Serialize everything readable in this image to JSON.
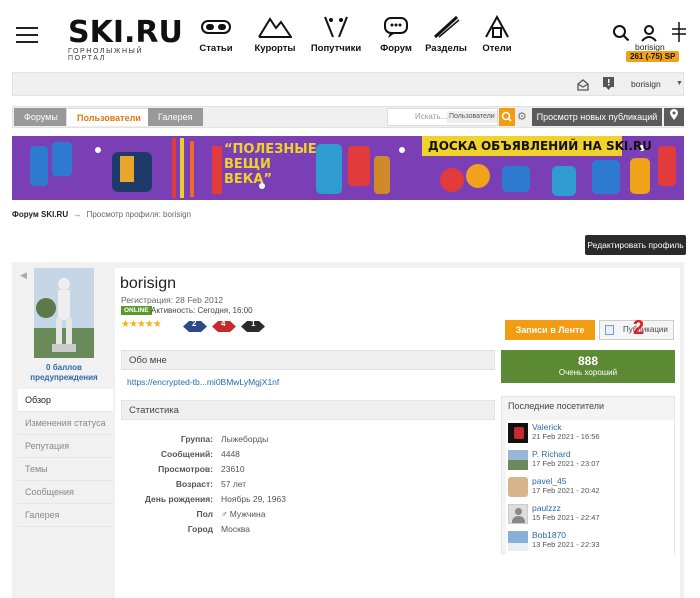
{
  "header": {
    "logo_text": "SKI.RU",
    "logo_subtitle": "ГОРНОЛЫЖНЫЙ ПОРТАЛ",
    "nav": [
      {
        "label": "Статьи",
        "icon": "goggles-icon"
      },
      {
        "label": "Курорты",
        "icon": "mountains-icon"
      },
      {
        "label": "Попутчики",
        "icon": "skiers-icon"
      },
      {
        "label": "Форум",
        "icon": "forum-icon"
      },
      {
        "label": "Разделы",
        "icon": "ski-icon"
      },
      {
        "label": "Отели",
        "icon": "hotel-icon"
      }
    ],
    "user_name": "borisign",
    "user_sp": "261 (-75) SP"
  },
  "userbar": {
    "user_name": "borisign"
  },
  "tabs": {
    "items": [
      "Форумы",
      "Пользователи",
      "Галерея"
    ],
    "active": "Пользователи",
    "search_placeholder": "Искать...",
    "search_scope": "Пользователи",
    "new_posts": "Просмотр новых публикаций"
  },
  "banner": {
    "text_left": "“ПОЛЕЗНЫЕ ВЕЩИ ВЕКА”",
    "text_right": "ДОСКА ОБЪЯВЛЕНИЙ НА SKI.RU"
  },
  "breadcrumb": {
    "root": "Форум SKI.RU",
    "sep": "→",
    "current": "Просмотр профиля: borisign"
  },
  "edit_profile": "Редактировать профиль",
  "profile": {
    "points": "0 баллов",
    "warnings": "предупреждения",
    "name": "borisign",
    "registration": "Регистрация: 28 Feb 2012",
    "online_badge": "ONLINE",
    "activity": "Активность: Сегодня, 16:00",
    "rank_badges": [
      "2",
      "4",
      "1"
    ],
    "feed_button": "Записи в Ленте",
    "publications_button": "Публикации",
    "step_number": "2"
  },
  "sidebar_menu": [
    "Обзор",
    "Изменения статуса",
    "Репутация",
    "Темы",
    "Сообщения",
    "Галерея"
  ],
  "about": {
    "title": "Обо мне",
    "link": "https://encrypted-tb...mi0BMwLyMgjX1nf"
  },
  "stats": {
    "title": "Статистика",
    "rows": [
      {
        "label": "Группа:",
        "value": "Лыжеборды"
      },
      {
        "label": "Сообщений:",
        "value": "4448"
      },
      {
        "label": "Просмотров:",
        "value": "23610"
      },
      {
        "label": "Возраст:",
        "value": "57 лет"
      },
      {
        "label": "День рождения:",
        "value": "Ноябрь 29, 1963"
      },
      {
        "label": "Пол",
        "value": "Мужчина"
      },
      {
        "label": "Город",
        "value": "Москва"
      }
    ]
  },
  "reputation": {
    "value": "888",
    "label": "Очень хороший",
    "color": "#5c8a34"
  },
  "visitors": {
    "title": "Последние посетители",
    "items": [
      {
        "name": "Valerick",
        "date": "21 Feb 2021 - 16:56"
      },
      {
        "name": "P. Richard",
        "date": "17 Feb 2021 - 23:07"
      },
      {
        "name": "pavel_45",
        "date": "17 Feb 2021 - 20:42"
      },
      {
        "name": "paulzzz",
        "date": "15 Feb 2021 - 22:47"
      },
      {
        "name": "Bob1870",
        "date": "13 Feb 2021 - 22:33"
      }
    ]
  }
}
